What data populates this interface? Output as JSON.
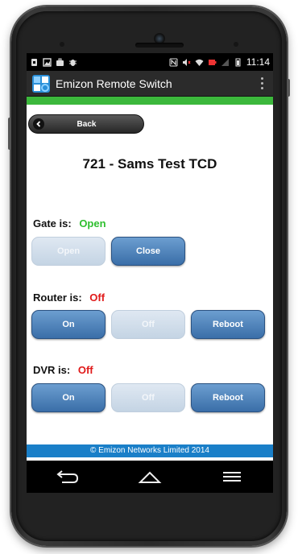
{
  "statusbar": {
    "time": "11:14",
    "left_icons": [
      "sim-icon",
      "image-icon",
      "briefcase-icon",
      "bug-icon"
    ],
    "right_icons": [
      "nfc-icon",
      "mute-icon",
      "wifi-icon",
      "battery-low-icon",
      "signal-icon",
      "battery-icon"
    ]
  },
  "app": {
    "title": "Emizon Remote Switch",
    "accent": "#3cb83c"
  },
  "page": {
    "back_label": "Back",
    "device_title": "721 - Sams Test TCD"
  },
  "gate": {
    "label": "Gate is:",
    "state": "Open",
    "state_color": "#2fbf2f",
    "open_label": "Open",
    "close_label": "Close"
  },
  "router": {
    "label": "Router is:",
    "state": "Off",
    "state_color": "#e01a1a",
    "on_label": "On",
    "off_label": "Off",
    "reboot_label": "Reboot"
  },
  "dvr": {
    "label": "DVR is:",
    "state": "Off",
    "state_color": "#e01a1a",
    "on_label": "On",
    "off_label": "Off",
    "reboot_label": "Reboot"
  },
  "footer": {
    "text": "© Emizon Networks Limited 2014"
  },
  "navbar": {
    "icons": [
      "back-icon",
      "home-icon",
      "menu-icon"
    ]
  }
}
